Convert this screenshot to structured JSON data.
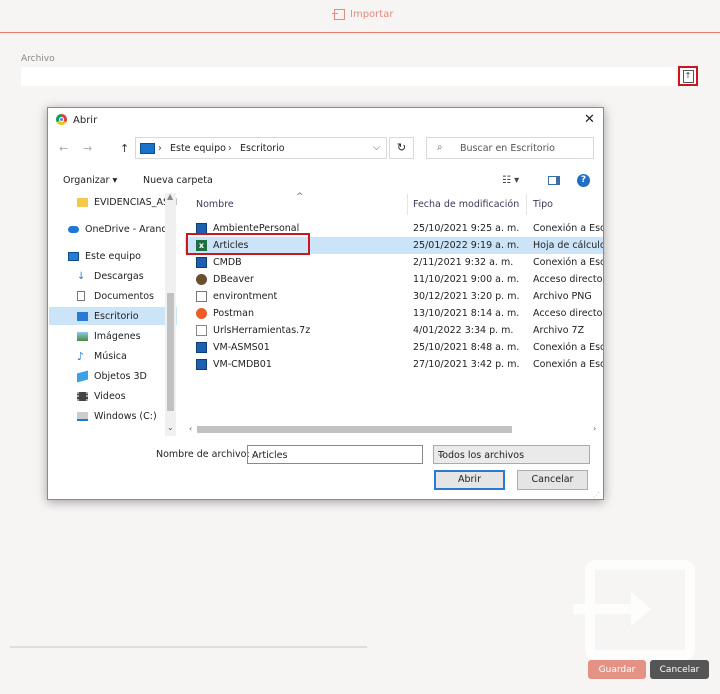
{
  "page": {
    "header_title": "Importar",
    "archivo_label": "Archivo",
    "guardar_label": "Guardar",
    "cancelar_label": "Cancelar"
  },
  "dialog": {
    "title": "Abrir",
    "close_glyph": "✕",
    "breadcrumb": [
      "Este equipo",
      "Escritorio"
    ],
    "search_placeholder": "Buscar en Escritorio",
    "toolbar": {
      "organize_label": "Organizar ▾",
      "new_folder_label": "Nueva carpeta",
      "help_glyph": "?"
    },
    "tree": [
      {
        "label": "EVIDENCIAS_ASM",
        "icon": "folder-icon",
        "indent": 1
      },
      {
        "label": "OneDrive - Aranda",
        "icon": "cloud-icon",
        "indent": 0
      },
      {
        "label": "Este equipo",
        "icon": "computer-icon",
        "indent": 0
      },
      {
        "label": "Descargas",
        "icon": "download-icon",
        "indent": 1
      },
      {
        "label": "Documentos",
        "icon": "document-icon",
        "indent": 1
      },
      {
        "label": "Escritorio",
        "icon": "desktop-icon",
        "indent": 1,
        "selected": true
      },
      {
        "label": "Imágenes",
        "icon": "pictures-icon",
        "indent": 1
      },
      {
        "label": "Música",
        "icon": "music-icon",
        "indent": 1
      },
      {
        "label": "Objetos 3D",
        "icon": "cube-icon",
        "indent": 1
      },
      {
        "label": "Videos",
        "icon": "video-icon",
        "indent": 1
      },
      {
        "label": "Windows (C:)",
        "icon": "drive-icon",
        "indent": 1
      }
    ],
    "columns": {
      "name": "Nombre",
      "date": "Fecha de modificación",
      "type": "Tipo"
    },
    "files": [
      {
        "name": "AmbientePersonal",
        "date": "25/10/2021 9:25 a. m.",
        "type": "Conexión a Escritorio",
        "icon": "rdp-icon"
      },
      {
        "name": "Articles",
        "date": "25/01/2022 9:19 a. m.",
        "type": "Hoja de cálculo",
        "icon": "excel-icon",
        "selected": true
      },
      {
        "name": "CMDB",
        "date": "2/11/2021 9:32 a. m.",
        "type": "Conexión a Escritorio",
        "icon": "rdp-icon"
      },
      {
        "name": "DBeaver",
        "date": "11/10/2021 9:00 a. m.",
        "type": "Acceso directo",
        "icon": "dbeaver-icon"
      },
      {
        "name": "environtment",
        "date": "30/12/2021 3:20 p. m.",
        "type": "Archivo PNG",
        "icon": "image-file-icon"
      },
      {
        "name": "Postman",
        "date": "13/10/2021 8:14 a. m.",
        "type": "Acceso directo",
        "icon": "postman-icon"
      },
      {
        "name": "UrlsHerramientas.7z",
        "date": "4/01/2022 3:34 p. m.",
        "type": "Archivo 7Z",
        "icon": "archive-icon"
      },
      {
        "name": "VM-ASMS01",
        "date": "25/10/2021 8:48 a. m.",
        "type": "Conexión a Escritorio",
        "icon": "rdp-icon"
      },
      {
        "name": "VM-CMDB01",
        "date": "27/10/2021 3:42 p. m.",
        "type": "Conexión a Escritorio",
        "icon": "rdp-icon"
      }
    ],
    "filename_label": "Nombre de archivo:",
    "filename_value": "Articles",
    "filetype_value": "Todos los archivos",
    "open_label": "Abrir",
    "cancel_label": "Cancelar"
  },
  "colors": {
    "accent": "#e87b6a",
    "highlight_box": "#c9171d",
    "selection": "#cce4f7"
  }
}
